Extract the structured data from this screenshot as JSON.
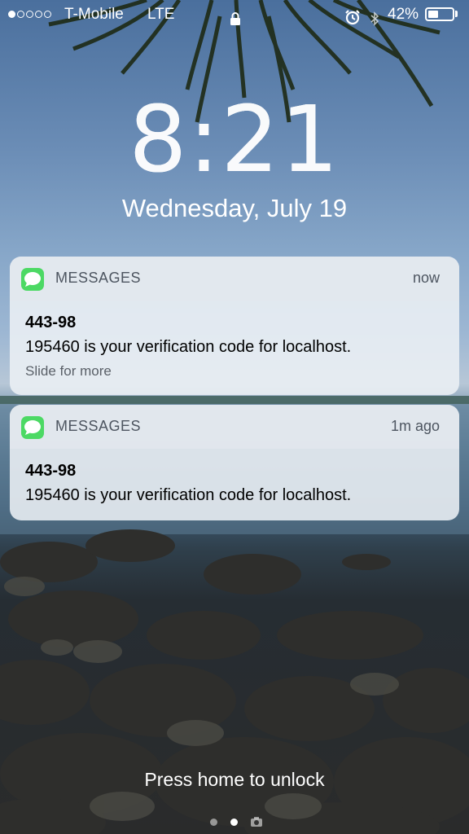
{
  "status_bar": {
    "signal_filled": 1,
    "signal_total": 5,
    "carrier": "T-Mobile",
    "network": "LTE",
    "battery": "42%",
    "battery_level": 0.42,
    "lock_icon": "lock-icon",
    "alarm_icon": "alarm-icon",
    "bluetooth_icon": "bluetooth-icon"
  },
  "lock_screen": {
    "time": "8:21",
    "date": "Wednesday, July 19",
    "unlock_hint": "Press home to unlock"
  },
  "notifications": [
    {
      "app": "MESSAGES",
      "time": "now",
      "sender": "443-98",
      "body": "195460 is your verification code for localhost.",
      "hint": "Slide for more"
    },
    {
      "app": "MESSAGES",
      "time": "1m ago",
      "sender": "443-98",
      "body": "195460 is your verification code for localhost."
    }
  ],
  "page_indicator": {
    "pages": [
      "dot",
      "dot-active",
      "camera-icon"
    ]
  },
  "colors": {
    "messages_green": "#4cd964"
  }
}
